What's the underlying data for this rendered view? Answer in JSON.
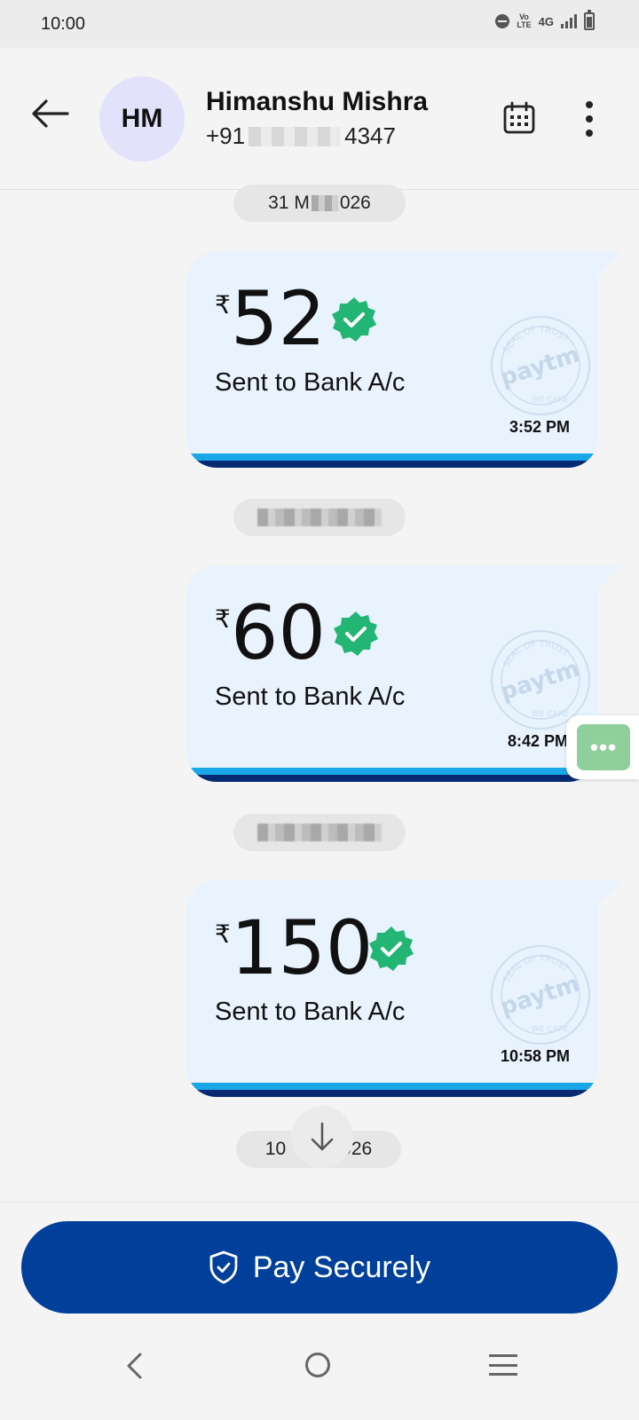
{
  "status_bar": {
    "time": "10:00",
    "network": "4G",
    "volte_top": "Vo",
    "volte_bottom": "LTE"
  },
  "header": {
    "avatar_initials": "HM",
    "contact_name": "Himanshu Mishra",
    "phone_prefix": "+91",
    "phone_suffix": "4347",
    "icons": [
      "back-arrow-icon",
      "calendar-icon",
      "more-vertical-icon"
    ]
  },
  "dates": {
    "first_left": "31 M",
    "first_right": "026",
    "last_left": "10",
    "last_right": "026"
  },
  "messages": [
    {
      "currency": "₹",
      "amount": "52",
      "label": "Sent to Bank A/c",
      "time": "3:52 PM"
    },
    {
      "currency": "₹",
      "amount": "60",
      "label": "Sent to Bank A/c",
      "time": "8:42 PM"
    },
    {
      "currency": "₹",
      "amount": "150",
      "label": "Sent to Bank A/c",
      "time": "10:58 PM"
    }
  ],
  "seal": {
    "top_text": "SEAL OF TRUST",
    "brand": "paytm",
    "bottom_text": "WE CARE"
  },
  "float_more": {
    "label": "•••"
  },
  "pay_button": {
    "label": "Pay Securely"
  },
  "colors": {
    "accent": "#01409a",
    "bubble_bg": "#e8f3fd",
    "verified_green": "#22b574",
    "stripe_light": "#1aa7e8",
    "stripe_dark": "#062b73"
  }
}
